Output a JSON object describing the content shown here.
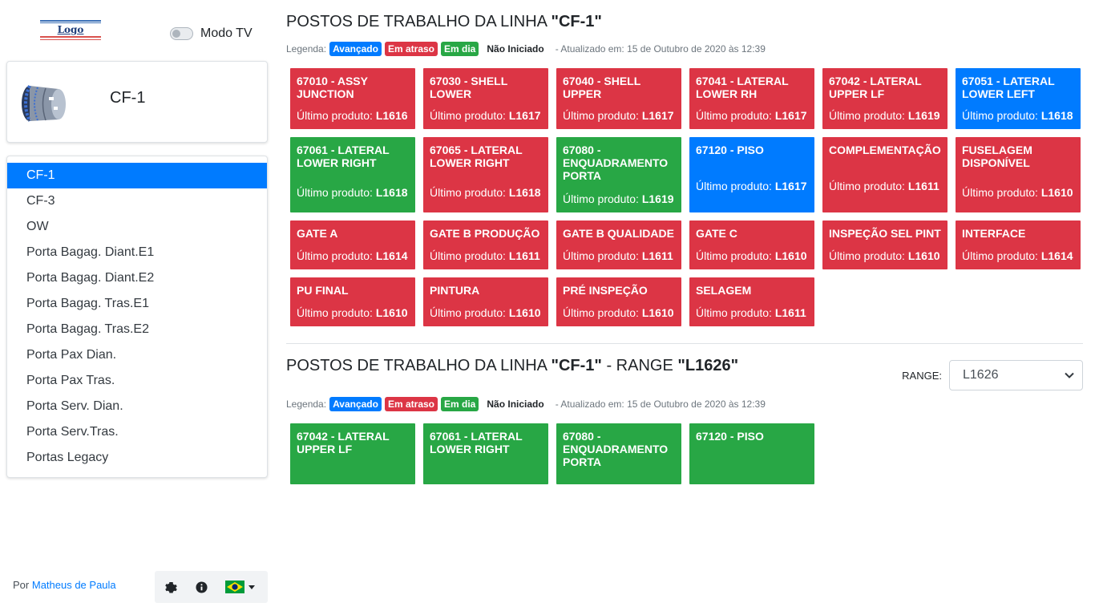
{
  "logo": {
    "text": "Logo"
  },
  "tv_mode": {
    "label": "Modo TV",
    "enabled": false
  },
  "current_line": {
    "name": "CF-1",
    "image_icon": "fuselage-icon"
  },
  "lines": [
    {
      "label": "CF-1",
      "active": true
    },
    {
      "label": "CF-3",
      "active": false
    },
    {
      "label": "OW",
      "active": false
    },
    {
      "label": "Porta Bagag. Diant.E1",
      "active": false
    },
    {
      "label": "Porta Bagag. Diant.E2",
      "active": false
    },
    {
      "label": "Porta Bagag. Tras.E1",
      "active": false
    },
    {
      "label": "Porta Bagag. Tras.E2",
      "active": false
    },
    {
      "label": "Porta Pax Dian.",
      "active": false
    },
    {
      "label": "Porta Pax Tras.",
      "active": false
    },
    {
      "label": "Porta Serv. Dian.",
      "active": false
    },
    {
      "label": "Porta Serv.Tras.",
      "active": false
    },
    {
      "label": "Portas Legacy",
      "active": false
    }
  ],
  "footer": {
    "by": "Por",
    "author": "Matheus de Paula",
    "tools": [
      "gear-icon",
      "info-icon",
      "brazil-flag-icon"
    ]
  },
  "legend": {
    "label": "Legenda:",
    "advanced": "Avançado",
    "late": "Em atraso",
    "on_time": "Em dia",
    "not_started": "Não Iniciado",
    "updated": "- Atualizado em: 15 de Outubro de 2020 às 12:39"
  },
  "colors": {
    "advanced": "#007bff",
    "late": "#dc3545",
    "on_time": "#28a745"
  },
  "section1": {
    "title_prefix": "POSTOS DE TRABALHO DA LINHA",
    "line": "\"CF-1\"",
    "product_label": "Último produto:",
    "rows": [
      [
        {
          "name": "67010 - ASSY JUNCTION",
          "product": "L1616",
          "status": "late"
        },
        {
          "name": "67030 - SHELL LOWER",
          "product": "L1617",
          "status": "late"
        },
        {
          "name": "67040 - SHELL UPPER",
          "product": "L1617",
          "status": "late"
        },
        {
          "name": "67041 - LATERAL LOWER RH",
          "product": "L1617",
          "status": "late"
        },
        {
          "name": "67042 - LATERAL UPPER LF",
          "product": "L1619",
          "status": "late"
        },
        {
          "name": "67051 - LATERAL LOWER LEFT",
          "product": "L1618",
          "status": "advanced"
        }
      ],
      [
        {
          "name": "67061 - LATERAL LOWER RIGHT",
          "product": "L1618",
          "status": "on_time"
        },
        {
          "name": "67065 - LATERAL LOWER RIGHT",
          "product": "L1618",
          "status": "late"
        },
        {
          "name": "67080 - ENQUADRAMENTO PORTA",
          "product": "L1619",
          "status": "on_time"
        },
        {
          "name": "67120 - PISO",
          "product": "L1617",
          "status": "advanced"
        },
        {
          "name": "COMPLEMENTAÇÃO",
          "product": "L1611",
          "status": "late"
        },
        {
          "name": "FUSELAGEM DISPONÍVEL",
          "product": "L1610",
          "status": "late"
        }
      ],
      [
        {
          "name": "GATE A",
          "product": "L1614",
          "status": "late"
        },
        {
          "name": "GATE B PRODUÇÃO",
          "product": "L1611",
          "status": "late"
        },
        {
          "name": "GATE B QUALIDADE",
          "product": "L1611",
          "status": "late"
        },
        {
          "name": "GATE C",
          "product": "L1610",
          "status": "late"
        },
        {
          "name": "INSPEÇÃO SEL PINT",
          "product": "L1610",
          "status": "late"
        },
        {
          "name": "INTERFACE",
          "product": "L1614",
          "status": "late"
        }
      ],
      [
        {
          "name": "PU FINAL",
          "product": "L1610",
          "status": "late"
        },
        {
          "name": "PINTURA",
          "product": "L1610",
          "status": "late"
        },
        {
          "name": "PRÉ INSPEÇÃO",
          "product": "L1610",
          "status": "late"
        },
        {
          "name": "SELAGEM",
          "product": "L1611",
          "status": "late"
        }
      ]
    ]
  },
  "section2": {
    "title_prefix": "POSTOS DE TRABALHO DA LINHA",
    "line": "\"CF-1\"",
    "range_word": "- RANGE",
    "range": "\"L1626\"",
    "range_label": "RANGE:",
    "range_selected": "L1626",
    "cards": [
      {
        "name": "67042 - LATERAL UPPER LF",
        "status": "on_time"
      },
      {
        "name": "67061 - LATERAL LOWER RIGHT",
        "status": "on_time"
      },
      {
        "name": "67080 - ENQUADRAMENTO PORTA",
        "status": "on_time"
      },
      {
        "name": "67120 - PISO",
        "status": "on_time"
      }
    ]
  }
}
